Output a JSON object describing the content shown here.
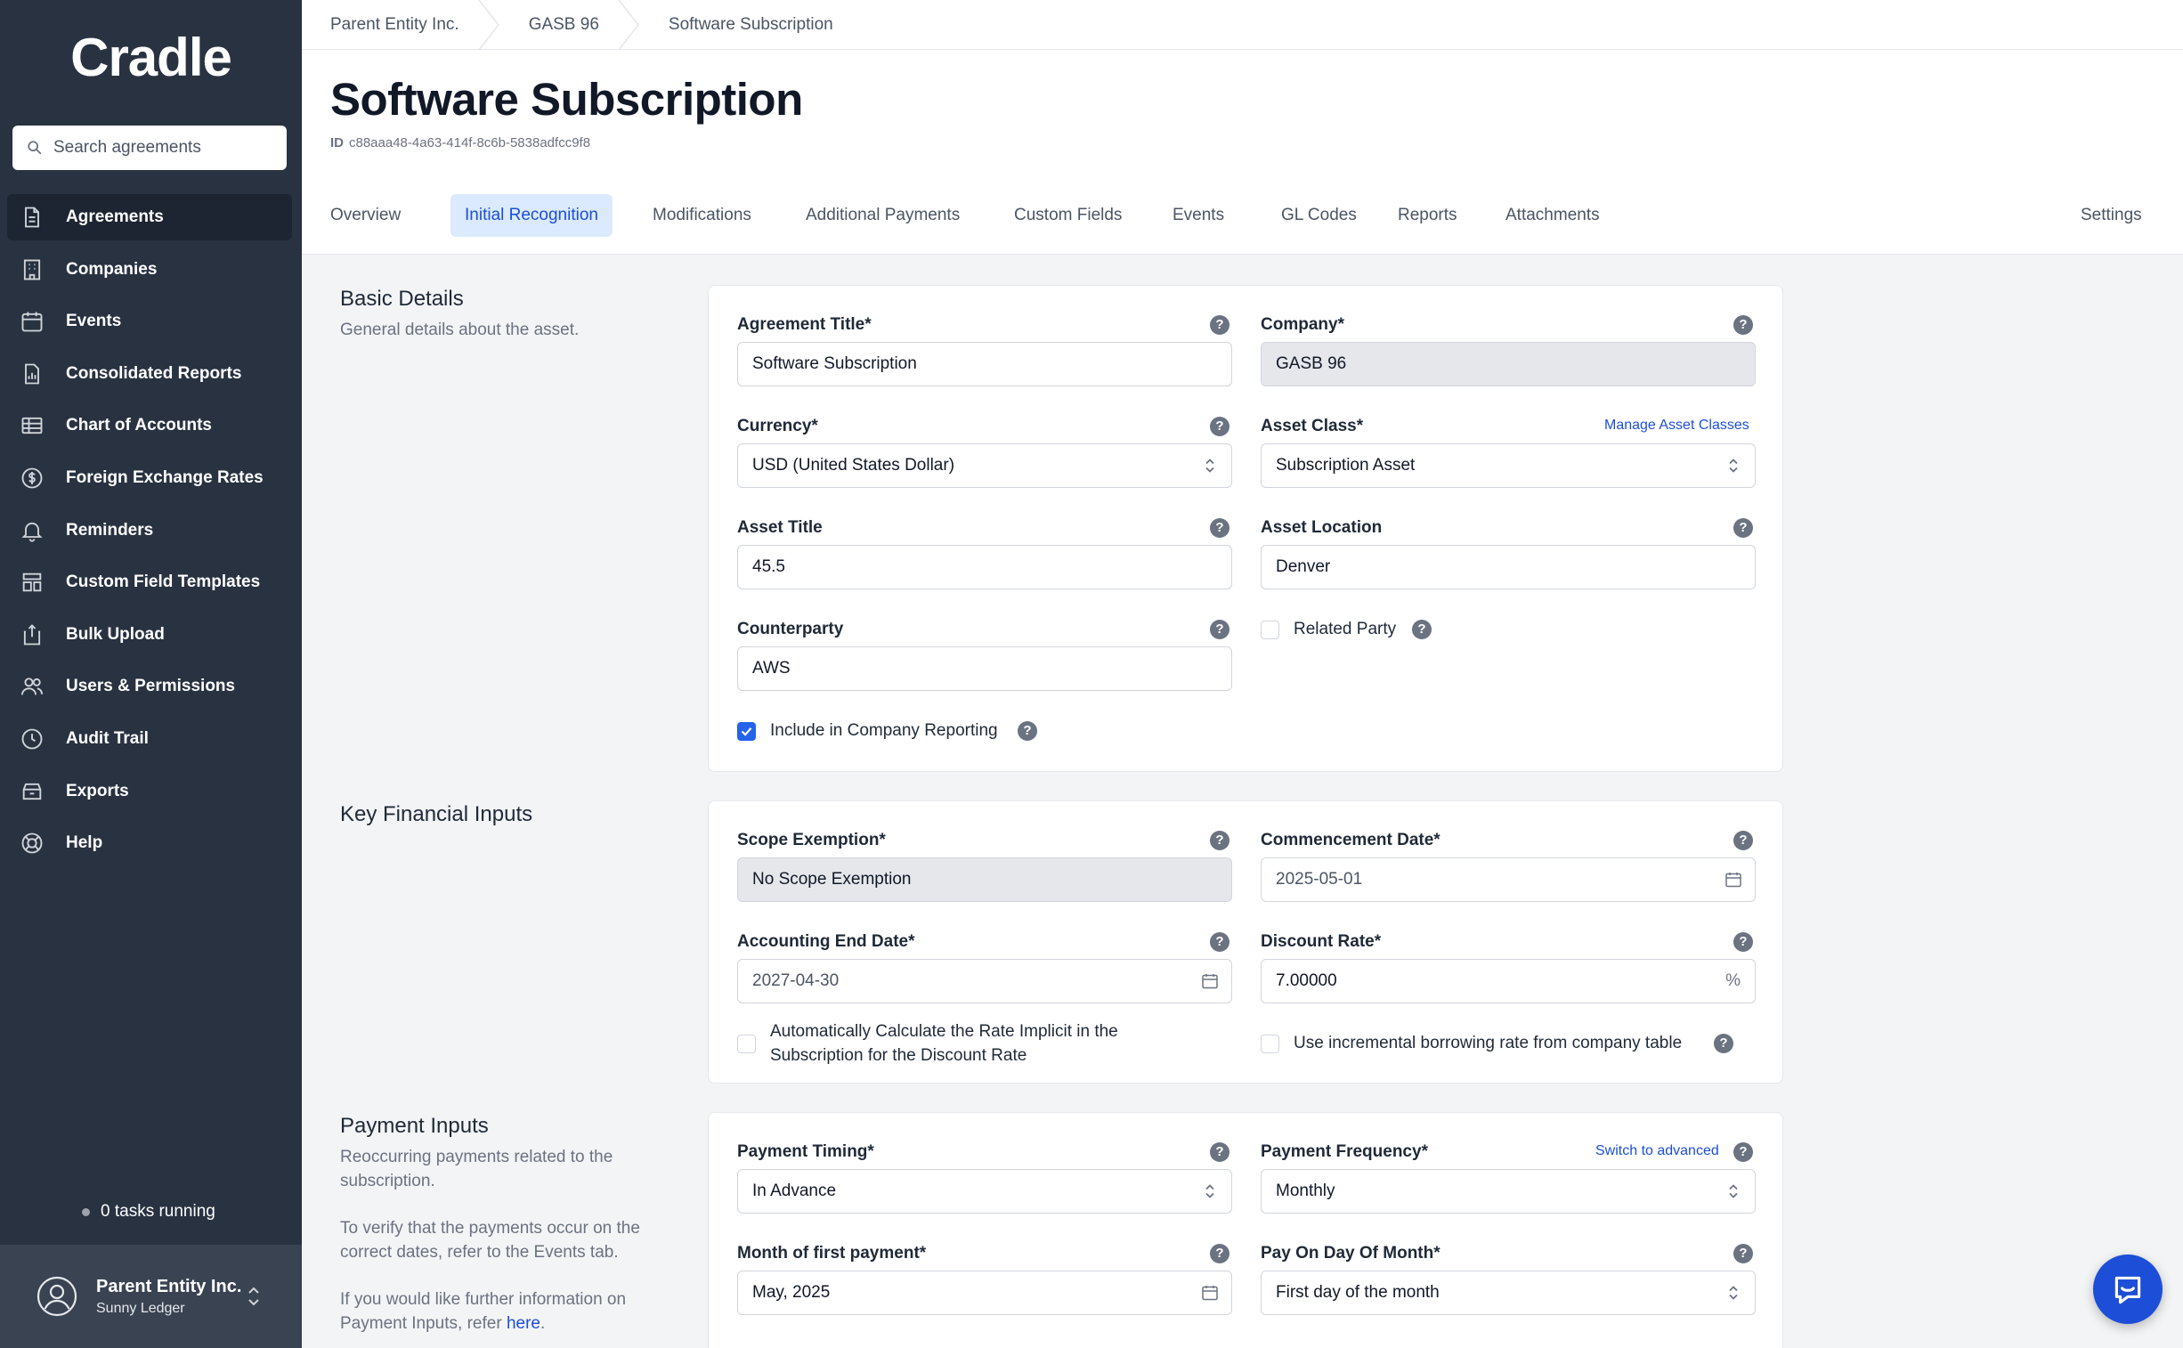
{
  "sidebar": {
    "logo": "Cradle",
    "search_placeholder": "Search agreements",
    "items": [
      {
        "label": "Agreements",
        "icon": "document-icon"
      },
      {
        "label": "Companies",
        "icon": "building-icon"
      },
      {
        "label": "Events",
        "icon": "calendar-icon"
      },
      {
        "label": "Consolidated Reports",
        "icon": "report-chart-icon"
      },
      {
        "label": "Chart of Accounts",
        "icon": "table-icon"
      },
      {
        "label": "Foreign Exchange Rates",
        "icon": "currency-icon"
      },
      {
        "label": "Reminders",
        "icon": "bell-icon"
      },
      {
        "label": "Custom Field Templates",
        "icon": "template-icon"
      },
      {
        "label": "Bulk Upload",
        "icon": "upload-icon"
      },
      {
        "label": "Users & Permissions",
        "icon": "users-icon"
      },
      {
        "label": "Audit Trail",
        "icon": "clock-icon"
      },
      {
        "label": "Exports",
        "icon": "archive-icon"
      },
      {
        "label": "Help",
        "icon": "lifebuoy-icon"
      }
    ],
    "tasks": "0 tasks running",
    "account": {
      "org": "Parent Entity Inc.",
      "user": "Sunny Ledger"
    }
  },
  "breadcrumbs": [
    "Parent Entity Inc.",
    "GASB 96",
    "Software Subscription"
  ],
  "page": {
    "title": "Software Subscription",
    "id_label": "ID",
    "id_value": "c88aaa48-4a63-414f-8c6b-5838adfcc9f8"
  },
  "tabs": [
    "Overview",
    "Initial Recognition",
    "Modifications",
    "Additional Payments",
    "Custom Fields",
    "Events",
    "GL Codes",
    "Reports",
    "Attachments",
    "Settings"
  ],
  "basic": {
    "title": "Basic Details",
    "subtitle": "General details about the asset.",
    "agreement_title_label": "Agreement Title*",
    "agreement_title_value": "Software Subscription",
    "company_label": "Company*",
    "company_value": "GASB 96",
    "currency_label": "Currency*",
    "currency_value": "USD (United States Dollar)",
    "asset_class_label": "Asset Class*",
    "asset_class_link": "Manage Asset Classes",
    "asset_class_value": "Subscription Asset",
    "asset_title_label": "Asset Title",
    "asset_title_value": "45.5",
    "asset_location_label": "Asset Location",
    "asset_location_value": "Denver",
    "counterparty_label": "Counterparty",
    "counterparty_value": "AWS",
    "related_party_label": "Related Party",
    "include_reporting_label": "Include in Company Reporting"
  },
  "financial": {
    "title": "Key Financial Inputs",
    "scope_label": "Scope Exemption*",
    "scope_value": "No Scope Exemption",
    "commencement_label": "Commencement Date*",
    "commencement_value": "2025-05-01",
    "end_date_label": "Accounting End Date*",
    "end_date_value": "2027-04-30",
    "discount_label": "Discount Rate*",
    "discount_value": "7.00000",
    "discount_unit": "%",
    "auto_calc_label": "Automatically Calculate the Rate Implicit in the Subscription for the Discount Rate",
    "ibr_label": "Use incremental borrowing rate from company table"
  },
  "payment": {
    "title": "Payment Inputs",
    "subtitle1": "Reoccurring payments related to the subscription.",
    "subtitle2": "To verify that the payments occur on the correct dates, refer to the Events tab.",
    "subtitle3": "If you would like further information on Payment Inputs, refer",
    "subtitle3_link": "here",
    "timing_label": "Payment Timing*",
    "timing_value": "In Advance",
    "frequency_label": "Payment Frequency*",
    "frequency_link": "Switch to advanced",
    "frequency_value": "Monthly",
    "first_month_label": "Month of first payment*",
    "first_month_value": "May, 2025",
    "pay_day_label": "Pay On Day Of Month*",
    "pay_day_value": "First day of the month"
  },
  "help_glyph": "?",
  "colors": {
    "sidebar": "#293241",
    "accent": "#1d4ed8",
    "tab_active_bg": "#dbeafe"
  }
}
